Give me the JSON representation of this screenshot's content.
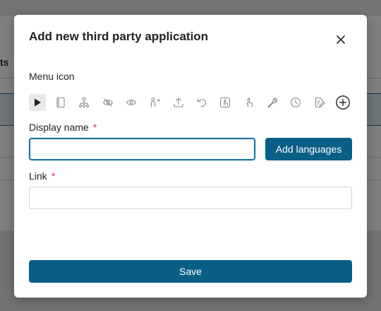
{
  "background": {
    "label_fragment": "ts"
  },
  "modal": {
    "title": "Add new third party application",
    "menu_icon_label": "Menu icon",
    "icons": [
      {
        "name": "play-icon",
        "selected": true
      },
      {
        "name": "book-icon"
      },
      {
        "name": "sitemap-icon"
      },
      {
        "name": "eye-slash-icon"
      },
      {
        "name": "eye-icon"
      },
      {
        "name": "person-arrow-icon"
      },
      {
        "name": "upload-icon"
      },
      {
        "name": "undo-icon"
      },
      {
        "name": "hand-pointer-square-icon"
      },
      {
        "name": "hand-pointer-icon"
      },
      {
        "name": "wrench-icon"
      },
      {
        "name": "clock-icon"
      },
      {
        "name": "file-edit-icon"
      },
      {
        "name": "add-circle-icon"
      }
    ],
    "display_name": {
      "label": "Display name",
      "required_mark": "*",
      "value": "",
      "placeholder": ""
    },
    "add_languages_label": "Add languages",
    "link": {
      "label": "Link",
      "required_mark": "*",
      "value": "",
      "placeholder": ""
    },
    "save_label": "Save"
  },
  "colors": {
    "primary": "#0a5f86",
    "focus_border": "#1673a1",
    "required": "#d9363e"
  }
}
